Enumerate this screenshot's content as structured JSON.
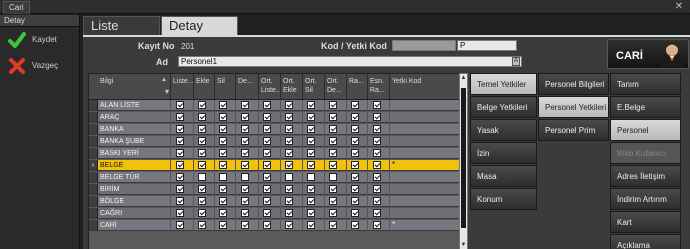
{
  "window": {
    "title": "Cari"
  },
  "left_panel": {
    "header": "Detay",
    "buttons": [
      {
        "label": "Kaydet",
        "icon": "check-icon",
        "color": "#3cc43c"
      },
      {
        "label": "Vazgeç",
        "icon": "close-icon",
        "color": "#e23a2a"
      }
    ]
  },
  "tabs": {
    "liste": "Liste",
    "detay": "Detay"
  },
  "form": {
    "kayit_no_label": "Kayıt No",
    "kayit_no_value": "201",
    "kod_label": "Kod / Yetki Kod",
    "kod_value": "",
    "yetki_kod_value": "P",
    "ad_label": "Ad",
    "ad_value": "Personel1",
    "ad_lock": "A"
  },
  "banner": {
    "title": "CARİ",
    "icon": "user-avatar-icon"
  },
  "grid": {
    "columns": [
      "Bilgi",
      "Liste...",
      "Ekle",
      "Sil",
      "De...",
      "Ort. Liste...",
      "Ort. Ekle",
      "Ort. Sil",
      "Ort. De...",
      "Ra...",
      "Esn. Ra...",
      "Yetki Kod"
    ],
    "selected_row": 5,
    "rows": [
      {
        "name": "ALAN LİSTE",
        "checks": [
          1,
          1,
          1,
          1,
          1,
          1,
          1,
          1,
          1,
          1
        ],
        "code": ""
      },
      {
        "name": "ARAÇ",
        "checks": [
          1,
          1,
          1,
          1,
          1,
          1,
          1,
          1,
          1,
          1
        ],
        "code": ""
      },
      {
        "name": "BANKA",
        "checks": [
          1,
          1,
          1,
          1,
          1,
          1,
          1,
          1,
          1,
          1
        ],
        "code": ""
      },
      {
        "name": "BANKA ŞUBE",
        "checks": [
          1,
          1,
          1,
          1,
          1,
          1,
          1,
          1,
          1,
          1
        ],
        "code": ""
      },
      {
        "name": "BASKI YERİ",
        "checks": [
          1,
          1,
          1,
          1,
          1,
          1,
          1,
          1,
          1,
          1
        ],
        "code": ""
      },
      {
        "name": "BELGE",
        "checks": [
          1,
          1,
          1,
          1,
          1,
          1,
          1,
          1,
          1,
          1
        ],
        "code": "*"
      },
      {
        "name": "BELGE TÜR",
        "checks": [
          1,
          0,
          0,
          0,
          1,
          0,
          0,
          0,
          1,
          1
        ],
        "code": ""
      },
      {
        "name": "BİRİM",
        "checks": [
          1,
          1,
          1,
          1,
          1,
          1,
          1,
          1,
          1,
          1
        ],
        "code": ""
      },
      {
        "name": "BÖLGE",
        "checks": [
          1,
          1,
          1,
          1,
          1,
          1,
          1,
          1,
          1,
          1
        ],
        "code": ""
      },
      {
        "name": "CAĞRI",
        "checks": [
          1,
          1,
          1,
          1,
          1,
          1,
          1,
          1,
          1,
          1
        ],
        "code": ""
      },
      {
        "name": "CARİ",
        "checks": [
          1,
          1,
          1,
          1,
          1,
          1,
          1,
          1,
          1,
          1
        ],
        "code": "*"
      }
    ]
  },
  "nav_col1": [
    "Temel Yetkiler",
    "Belge Yetkileri",
    "Yasak",
    "İzin",
    "Masa",
    "Konum"
  ],
  "nav_col2": [
    "Personel Bilgileri",
    "Personel Yetkileri",
    "Personel Prim"
  ],
  "nav_col3": [
    "Tanım",
    "E.Belge",
    "Personel",
    "Web Kullanıcı",
    "Adres İletişim Yetkili",
    "İndirim Artırım",
    "Kart",
    "Açıklama"
  ]
}
